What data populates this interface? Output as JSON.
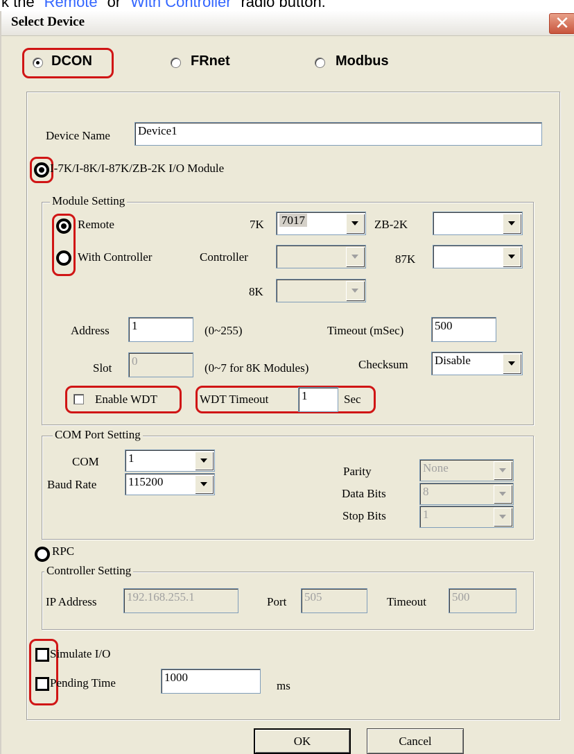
{
  "instruction": {
    "prefix": "k the \"",
    "link1": "Remote",
    "middle": "\" or \"",
    "link2": "With Controller",
    "suffix": "\" radio button."
  },
  "window": {
    "title": "Select Device",
    "close_glyph": "✕"
  },
  "protocol": {
    "options": [
      {
        "label": "DCON",
        "selected": true
      },
      {
        "label": "FRnet",
        "selected": false
      },
      {
        "label": "Modbus",
        "selected": false
      }
    ]
  },
  "device_name": {
    "label": "Device Name",
    "value": "Device1"
  },
  "io_module_option": {
    "label": "I-7K/I-8K/I-87K/ZB-2K I/O Module",
    "selected": true
  },
  "module_setting": {
    "legend": "Module Setting",
    "remote_label": "Remote",
    "with_controller_label": "With Controller",
    "label_7k": "7K",
    "value_7k": "7017",
    "label_zb2k": "ZB-2K",
    "value_zb2k": "",
    "label_controller": "Controller",
    "value_controller": "",
    "label_87k": "87K",
    "value_87k": "",
    "label_8k": "8K",
    "value_8k": "",
    "address_label": "Address",
    "address_value": "1",
    "address_range": "(0~255)",
    "timeout_label": "Timeout (mSec)",
    "timeout_value": "500",
    "slot_label": "Slot",
    "slot_value": "0",
    "slot_range": "(0~7 for 8K Modules)",
    "checksum_label": "Checksum",
    "checksum_value": "Disable",
    "enable_wdt_label": "Enable WDT",
    "wdt_timeout_label": "WDT Timeout",
    "wdt_timeout_value": "1",
    "wdt_unit": "Sec"
  },
  "com_port": {
    "legend": "COM Port Setting",
    "com_label": "COM",
    "com_value": "1",
    "baud_label": "Baud Rate",
    "baud_value": "115200",
    "parity_label": "Parity",
    "parity_value": "None",
    "databits_label": "Data Bits",
    "databits_value": "8",
    "stopbits_label": "Stop Bits",
    "stopbits_value": "1"
  },
  "rpc": {
    "label": "RPC",
    "legend": "Controller Setting",
    "ip_label": "IP Address",
    "ip_value": "192.168.255.1",
    "port_label": "Port",
    "port_value": "505",
    "timeout_label": "Timeout",
    "timeout_value": "500"
  },
  "options": {
    "simulate_label": "Simulate I/O",
    "pending_label": "Pending Time",
    "pending_value": "1000",
    "pending_unit": "ms"
  },
  "buttons": {
    "ok": "OK",
    "cancel": "Cancel"
  },
  "colors": {
    "highlight": "#d01515",
    "link": "#3366ff",
    "dialog_bg": "#ece9d8"
  }
}
